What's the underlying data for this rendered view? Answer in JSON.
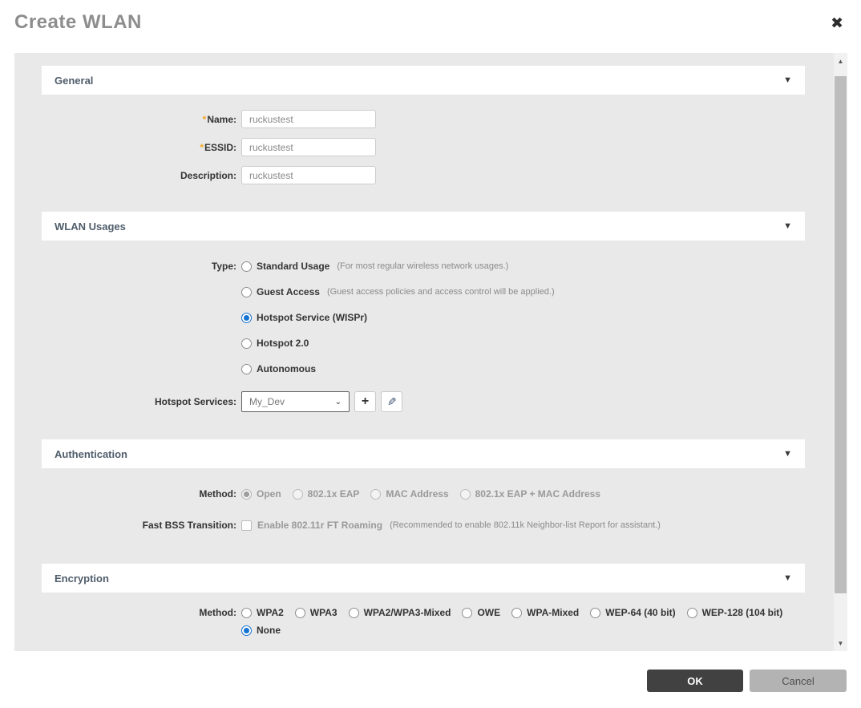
{
  "header": {
    "title": "Create WLAN",
    "close_icon": "✖"
  },
  "sections": {
    "general": {
      "title": "General",
      "fields": [
        {
          "required": "*",
          "label": "Name:",
          "value": "ruckustest"
        },
        {
          "required": "*",
          "label": "ESSID:",
          "value": "ruckustest"
        },
        {
          "required": "",
          "label": "Description:",
          "value": "ruckustest"
        }
      ]
    },
    "wlan_usages": {
      "title": "WLAN Usages",
      "type_label": "Type:",
      "type_options": [
        {
          "label": "Standard Usage",
          "hint": "(For most regular wireless network usages.)",
          "selected": false
        },
        {
          "label": "Guest Access",
          "hint": "(Guest access policies and access control will be applied.)",
          "selected": false
        },
        {
          "label": "Hotspot Service (WISPr)",
          "hint": "",
          "selected": true
        },
        {
          "label": "Hotspot 2.0",
          "hint": "",
          "selected": false
        },
        {
          "label": "Autonomous",
          "hint": "",
          "selected": false
        }
      ],
      "hotspot_services_label": "Hotspot Services:",
      "hotspot_services_selected": "My_Dev",
      "add_button_glyph": "+",
      "edit_button_glyph": "✎"
    },
    "authentication": {
      "title": "Authentication",
      "method_label": "Method:",
      "method_options": [
        {
          "label": "Open",
          "selected": true
        },
        {
          "label": "802.1x EAP",
          "selected": false
        },
        {
          "label": "MAC Address",
          "selected": false
        },
        {
          "label": "802.1x EAP + MAC Address",
          "selected": false
        }
      ],
      "fast_bss_label": "Fast BSS Transition:",
      "fast_bss_option": "Enable 802.11r FT Roaming",
      "fast_bss_hint": "(Recommended to enable 802.11k Neighbor-list Report for assistant.)",
      "fast_bss_checked": false
    },
    "encryption": {
      "title": "Encryption",
      "method_label": "Method:",
      "method_options_row1": [
        {
          "label": "WPA2",
          "selected": false
        },
        {
          "label": "WPA3",
          "selected": false
        },
        {
          "label": "WPA2/WPA3-Mixed",
          "selected": false
        },
        {
          "label": "OWE",
          "selected": false
        },
        {
          "label": "WPA-Mixed",
          "selected": false
        },
        {
          "label": "WEP-64 (40 bit)",
          "selected": false
        },
        {
          "label": "WEP-128 (104 bit)",
          "selected": false
        }
      ],
      "method_options_row2": [
        {
          "label": "None",
          "selected": true
        }
      ]
    }
  },
  "footer": {
    "ok_label": "OK",
    "cancel_label": "Cancel"
  },
  "icons": {
    "section_chevron": "▼",
    "select_chevron": "⌄",
    "scroll_up": "▲",
    "scroll_down": "▼"
  },
  "colors": {
    "accent_blue": "#1673d2",
    "section_header_text": "#4f5d6b",
    "required_asterisk": "#f5a623",
    "ok_button_bg": "#414141",
    "cancel_button_bg": "#b3b3b3",
    "panel_bg": "#e9e9e9"
  }
}
